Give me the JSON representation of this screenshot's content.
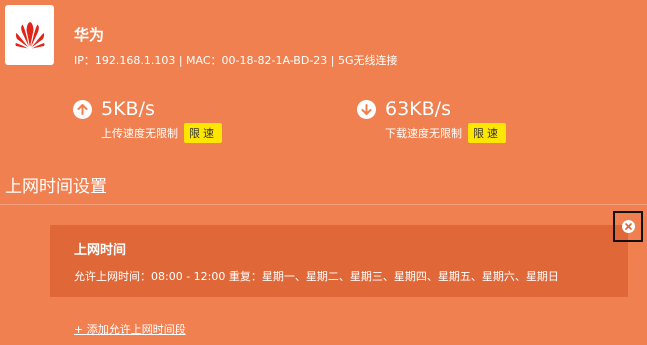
{
  "device": {
    "name": "华为",
    "info": "IP：192.168.1.103 | MAC：00-18-82-1A-BD-23 | 5G无线连接",
    "logo_icon": "huawei-logo",
    "logo_color": "#e2231a"
  },
  "upload": {
    "icon": "arrow-up-icon",
    "value": "5KB/s",
    "label": "上传速度无限制",
    "limit_button": "限速"
  },
  "download": {
    "icon": "arrow-down-icon",
    "value": "63KB/s",
    "label": "下载速度无限制",
    "limit_button": "限速"
  },
  "section": {
    "title": "上网时间设置"
  },
  "rule": {
    "title": "上网时间",
    "detail": "允许上网时间：08:00 - 12:00   重复：星期一、星期二、星期三、星期四、星期五、星期六、星期日",
    "close_icon": "close-icon"
  },
  "add_link": "+ 添加允许上网时间段",
  "colors": {
    "background": "#f08050",
    "card": "#e06838",
    "limit_badge": "#ffe600"
  }
}
